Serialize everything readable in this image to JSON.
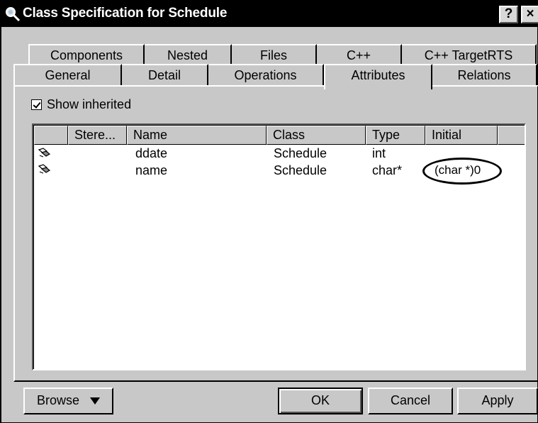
{
  "window": {
    "title": "Class Specification for Schedule",
    "help_glyph": "?",
    "close_glyph": "×"
  },
  "tabs": {
    "row1": [
      "Components",
      "Nested",
      "Files",
      "C++",
      "C++ TargetRTS"
    ],
    "row2": [
      "General",
      "Detail",
      "Operations",
      "Attributes",
      "Relations"
    ],
    "active": "Attributes"
  },
  "show_inherited": {
    "label": "Show inherited",
    "checked": true
  },
  "table": {
    "columns": [
      "Stere...",
      "Name",
      "Class",
      "Type",
      "Initial"
    ],
    "rows": [
      {
        "icon": "attribute-icon",
        "stereotype": "",
        "name": "ddate",
        "class": "Schedule",
        "type": "int",
        "initial": ""
      },
      {
        "icon": "attribute-icon",
        "stereotype": "",
        "name": "name",
        "class": "Schedule",
        "type": "char*",
        "initial": "(char *)0"
      }
    ]
  },
  "buttons": {
    "browse": "Browse",
    "ok": "OK",
    "cancel": "Cancel",
    "apply": "Apply"
  }
}
